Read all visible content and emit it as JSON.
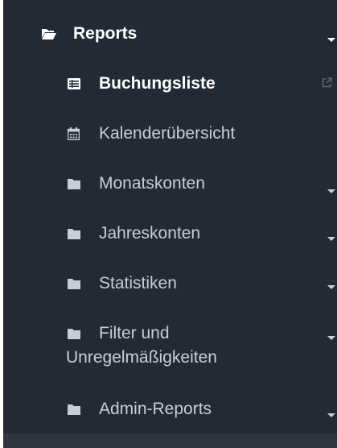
{
  "menu": {
    "reports": {
      "label": "Reports",
      "icon": "folder-open-icon"
    },
    "items": [
      {
        "label": "Buchungsliste",
        "icon": "list-icon",
        "active": true,
        "external": true
      },
      {
        "label": "Kalenderübersicht",
        "icon": "calendar-icon"
      },
      {
        "label": "Monatskonten",
        "icon": "folder-icon",
        "expandable": true
      },
      {
        "label": "Jahreskonten",
        "icon": "folder-icon",
        "expandable": true
      },
      {
        "label": "Statistiken",
        "icon": "folder-icon",
        "expandable": true
      },
      {
        "label_line1": "Filter und",
        "label_line2": "Unregelmäßigkeiten",
        "icon": "folder-icon",
        "expandable": true
      },
      {
        "label": "Admin-Reports",
        "icon": "folder-icon",
        "expandable": true
      }
    ]
  },
  "colors": {
    "sidebar_bg": "#232a35",
    "text": "#c9ced6",
    "active_text": "#ffffff"
  }
}
